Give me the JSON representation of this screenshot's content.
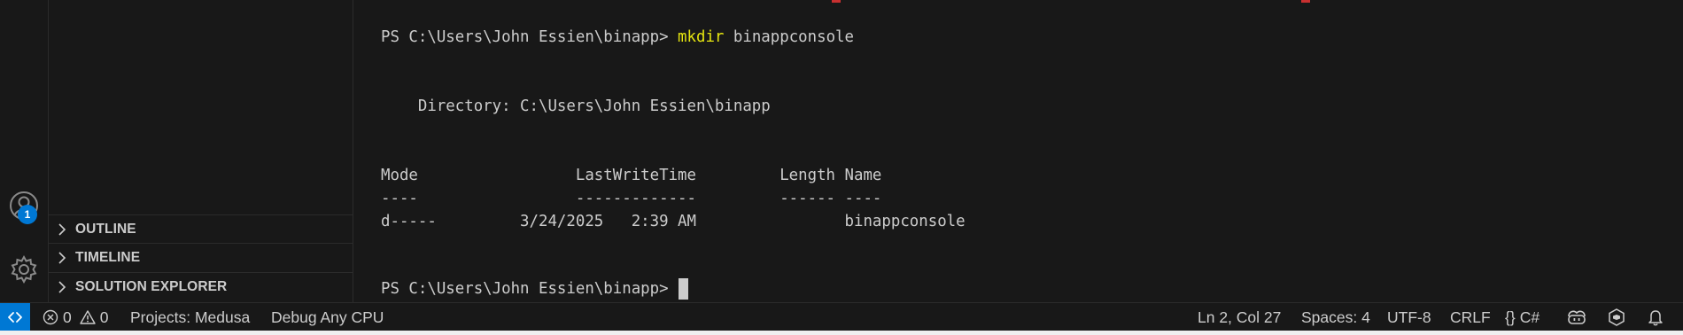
{
  "activity_bar": {
    "accounts_icon": "account-icon",
    "accounts_badge": "1",
    "manage_icon": "gear-icon"
  },
  "sidebar": {
    "panels": [
      {
        "label": "OUTLINE",
        "icon": "chevron-right-icon"
      },
      {
        "label": "TIMELINE",
        "icon": "chevron-right-icon"
      },
      {
        "label": "SOLUTION EXPLORER",
        "icon": "chevron-right-icon"
      }
    ]
  },
  "terminal": {
    "prompt1": "PS C:\\Users\\John Essien\\binapp> ",
    "cmd_name": "mkdir",
    "cmd_args": " binappconsole",
    "directory_line": "    Directory: C:\\Users\\John Essien\\binapp",
    "header_line": "Mode                 LastWriteTime         Length Name",
    "sep_line": "----                 -------------         ------ ----",
    "row_line": "d-----         3/24/2025   2:39 AM                binappconsole",
    "prompt2": "PS C:\\Users\\John Essien\\binapp>"
  },
  "statusbar": {
    "remote_icon": "remote-icon",
    "errors_count": "0",
    "warnings_count": "0",
    "projects": "Projects: Medusa",
    "debug": "Debug Any CPU",
    "position": "Ln 2, Col 27",
    "spaces": "Spaces: 4",
    "encoding": "UTF-8",
    "eol": "CRLF",
    "language": "C#",
    "copilot_icon": "copilot-icon",
    "csharp_devkit_icon": "csharp-devkit-icon",
    "bell_icon": "bell-icon"
  },
  "colors": {
    "background": "#181818",
    "accent": "#0078d4",
    "command": "#e5e510",
    "text": "#cccccc"
  }
}
